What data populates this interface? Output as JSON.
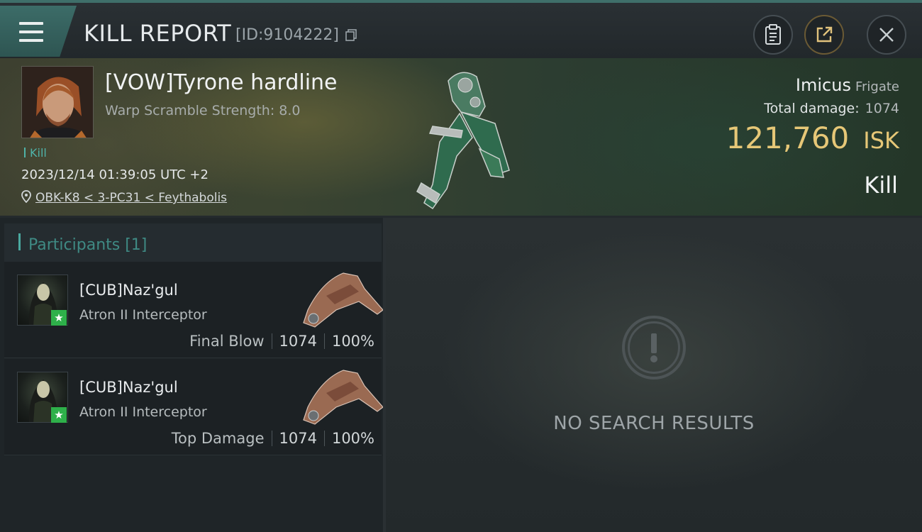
{
  "header": {
    "title": "KILL REPORT",
    "id_label": "[ID:9104222]"
  },
  "victim": {
    "name": "[VOW]Tyrone hardline",
    "warp_scramble": "Warp Scramble Strength: 8.0",
    "tag": "Kill",
    "timestamp": "2023/12/14 01:39:05 UTC +2",
    "location": "OBK-K8 < 3-PC31 < Feythabolis",
    "ship": "Imicus",
    "ship_class": "Frigate",
    "total_damage_label": "Total damage:",
    "total_damage": "1074",
    "isk_value": "121,760",
    "isk_unit": "ISK",
    "result": "Kill"
  },
  "participants": {
    "title": "Participants [1]",
    "rows": [
      {
        "name": "[CUB]Naz'gul",
        "ship": "Atron II Interceptor",
        "label": "Final Blow",
        "damage": "1074",
        "percent": "100%"
      },
      {
        "name": "[CUB]Naz'gul",
        "ship": "Atron II Interceptor",
        "label": "Top Damage",
        "damage": "1074",
        "percent": "100%"
      }
    ]
  },
  "empty_state": {
    "message": "NO SEARCH RESULTS"
  },
  "colors": {
    "accent_teal": "#4aa9a0",
    "isk_gold": "#e6c777",
    "star_green": "#2eb04a"
  }
}
